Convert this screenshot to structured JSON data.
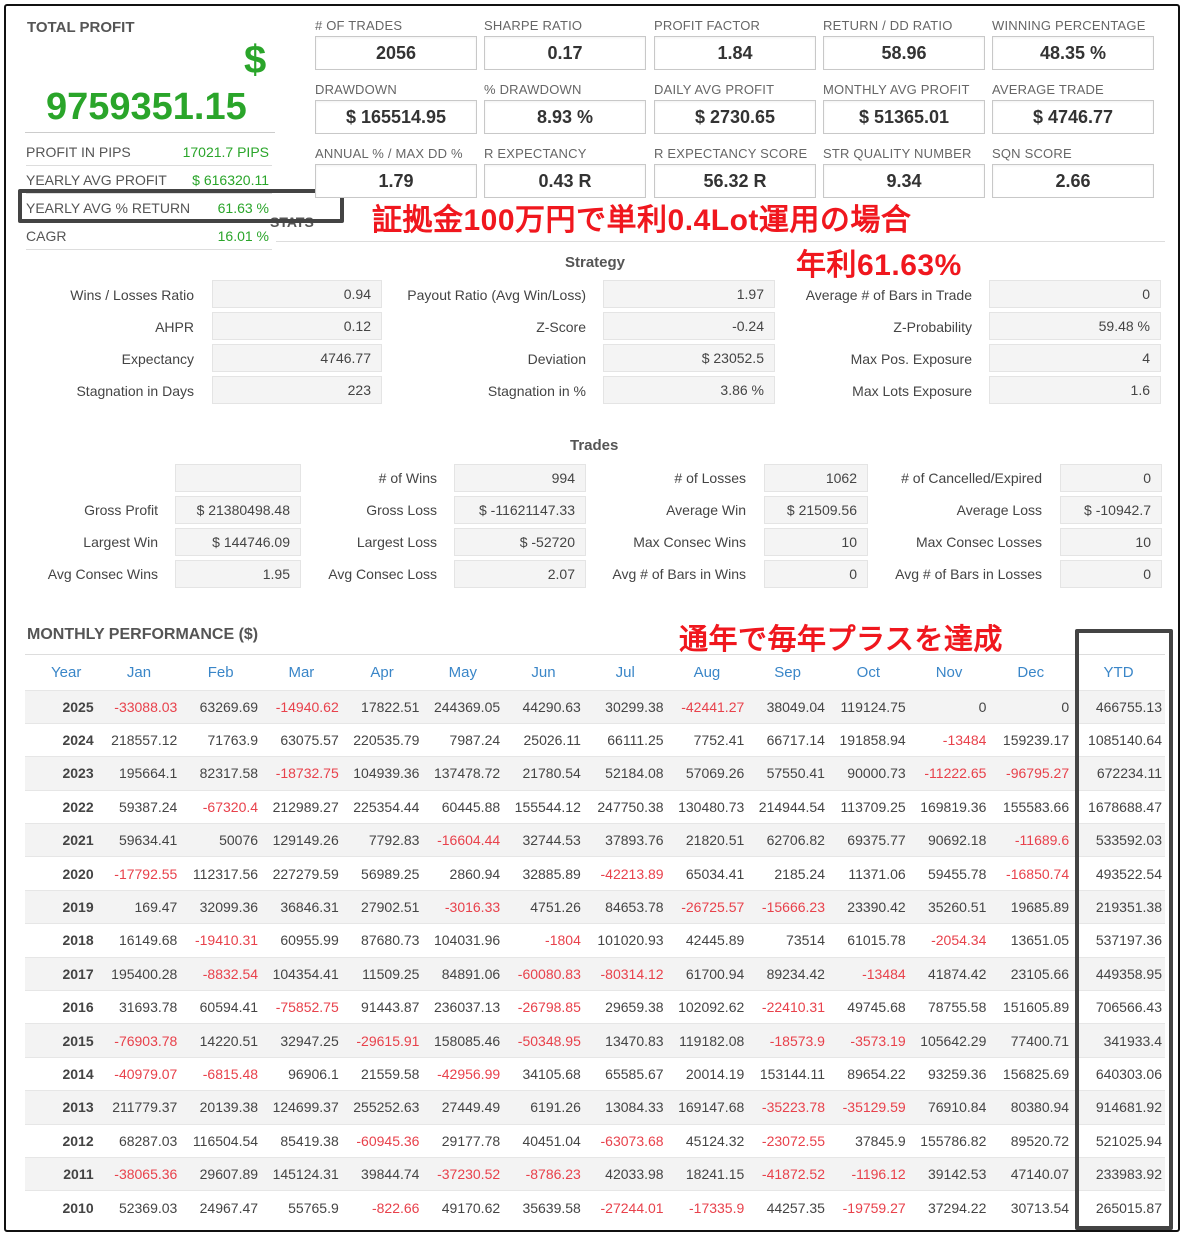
{
  "summary": {
    "total_profit_label": "TOTAL PROFIT",
    "currency_symbol": "$",
    "total_profit_value": "9759351.15",
    "rows": [
      {
        "label": "PROFIT IN PIPS",
        "value": "17021.7 PIPS"
      },
      {
        "label": "YEARLY AVG PROFIT",
        "value": "$ 616320.11"
      },
      {
        "label": "YEARLY AVG % RETURN",
        "value": "61.63 %"
      },
      {
        "label": "CAGR",
        "value": "16.01 %"
      }
    ],
    "stats_fragment": "STATS"
  },
  "kpis": [
    {
      "label": "# OF TRADES",
      "value": "2056"
    },
    {
      "label": "SHARPE RATIO",
      "value": "0.17"
    },
    {
      "label": "PROFIT FACTOR",
      "value": "1.84"
    },
    {
      "label": "RETURN / DD RATIO",
      "value": "58.96"
    },
    {
      "label": "WINNING PERCENTAGE",
      "value": "48.35 %"
    },
    {
      "label": "DRAWDOWN",
      "value": "$ 165514.95"
    },
    {
      "label": "% DRAWDOWN",
      "value": "8.93 %"
    },
    {
      "label": "DAILY AVG PROFIT",
      "value": "$ 2730.65"
    },
    {
      "label": "MONTHLY AVG PROFIT",
      "value": "$ 51365.01"
    },
    {
      "label": "AVERAGE TRADE",
      "value": "$ 4746.77"
    },
    {
      "label": "ANNUAL % / MAX DD %",
      "value": "1.79"
    },
    {
      "label": "R EXPECTANCY",
      "value": "0.43 R"
    },
    {
      "label": "R EXPECTANCY SCORE",
      "value": "56.32 R"
    },
    {
      "label": "STR QUALITY NUMBER",
      "value": "9.34"
    },
    {
      "label": "SQN SCORE",
      "value": "2.66"
    }
  ],
  "annotations": {
    "line1": "証拠金100万円で単利0.4Lot運用の場合",
    "line2": "年利61.63%",
    "line3": "通年で毎年プラスを達成"
  },
  "strategy": {
    "title": "Strategy",
    "rows": [
      [
        {
          "k": "Wins / Losses Ratio",
          "v": "0.94"
        },
        {
          "k": "Payout Ratio (Avg Win/Loss)",
          "v": "1.97"
        },
        {
          "k": "Average # of Bars in Trade",
          "v": "0"
        }
      ],
      [
        {
          "k": "AHPR",
          "v": "0.12"
        },
        {
          "k": "Z-Score",
          "v": "-0.24"
        },
        {
          "k": "Z-Probability",
          "v": "59.48 %"
        }
      ],
      [
        {
          "k": "Expectancy",
          "v": "4746.77"
        },
        {
          "k": "Deviation",
          "v": "$ 23052.5"
        },
        {
          "k": "Max Pos. Exposure",
          "v": "4"
        }
      ],
      [
        {
          "k": "Stagnation in Days",
          "v": "223"
        },
        {
          "k": "Stagnation in %",
          "v": "3.86 %"
        },
        {
          "k": "Max Lots Exposure",
          "v": "1.6"
        }
      ]
    ]
  },
  "trades": {
    "title": "Trades",
    "rows": [
      [
        {
          "k": "",
          "v": ""
        },
        {
          "k": "# of Wins",
          "v": "994"
        },
        {
          "k": "# of Losses",
          "v": "1062"
        },
        {
          "k": "# of Cancelled/Expired",
          "v": "0"
        }
      ],
      [
        {
          "k": "Gross Profit",
          "v": "$ 21380498.48"
        },
        {
          "k": "Gross Loss",
          "v": "$ -11621147.33"
        },
        {
          "k": "Average Win",
          "v": "$ 21509.56"
        },
        {
          "k": "Average Loss",
          "v": "$ -10942.7"
        }
      ],
      [
        {
          "k": "Largest Win",
          "v": "$ 144746.09"
        },
        {
          "k": "Largest Loss",
          "v": "$ -52720"
        },
        {
          "k": "Max Consec Wins",
          "v": "10"
        },
        {
          "k": "Max Consec Losses",
          "v": "10"
        }
      ],
      [
        {
          "k": "Avg Consec Wins",
          "v": "1.95"
        },
        {
          "k": "Avg Consec Loss",
          "v": "2.07"
        },
        {
          "k": "Avg # of Bars in Wins",
          "v": "0"
        },
        {
          "k": "Avg # of Bars in Losses",
          "v": "0"
        }
      ]
    ]
  },
  "monthly": {
    "title": "MONTHLY PERFORMANCE ($)",
    "headers": [
      "Year",
      "Jan",
      "Feb",
      "Mar",
      "Apr",
      "May",
      "Jun",
      "Jul",
      "Aug",
      "Sep",
      "Oct",
      "Nov",
      "Dec",
      "YTD"
    ],
    "rows": [
      [
        "2025",
        "-33088.03",
        "63269.69",
        "-14940.62",
        "17822.51",
        "244369.05",
        "44290.63",
        "30299.38",
        "-42441.27",
        "38049.04",
        "119124.75",
        "0",
        "0",
        "466755.13"
      ],
      [
        "2024",
        "218557.12",
        "71763.9",
        "63075.57",
        "220535.79",
        "7987.24",
        "25026.11",
        "66111.25",
        "7752.41",
        "66717.14",
        "191858.94",
        "-13484",
        "159239.17",
        "1085140.64"
      ],
      [
        "2023",
        "195664.1",
        "82317.58",
        "-18732.75",
        "104939.36",
        "137478.72",
        "21780.54",
        "52184.08",
        "57069.26",
        "57550.41",
        "90000.73",
        "-11222.65",
        "-96795.27",
        "672234.11"
      ],
      [
        "2022",
        "59387.24",
        "-67320.4",
        "212989.27",
        "225354.44",
        "60445.88",
        "155544.12",
        "247750.38",
        "130480.73",
        "214944.54",
        "113709.25",
        "169819.36",
        "155583.66",
        "1678688.47"
      ],
      [
        "2021",
        "59634.41",
        "50076",
        "129149.26",
        "7792.83",
        "-16604.44",
        "32744.53",
        "37893.76",
        "21820.51",
        "62706.82",
        "69375.77",
        "90692.18",
        "-11689.6",
        "533592.03"
      ],
      [
        "2020",
        "-17792.55",
        "112317.56",
        "227279.59",
        "56989.25",
        "2860.94",
        "32885.89",
        "-42213.89",
        "65034.41",
        "2185.24",
        "11371.06",
        "59455.78",
        "-16850.74",
        "493522.54"
      ],
      [
        "2019",
        "169.47",
        "32099.36",
        "36846.31",
        "27902.51",
        "-3016.33",
        "4751.26",
        "84653.78",
        "-26725.57",
        "-15666.23",
        "23390.42",
        "35260.51",
        "19685.89",
        "219351.38"
      ],
      [
        "2018",
        "16149.68",
        "-19410.31",
        "60955.99",
        "87680.73",
        "104031.96",
        "-1804",
        "101020.93",
        "42445.89",
        "73514",
        "61015.78",
        "-2054.34",
        "13651.05",
        "537197.36"
      ],
      [
        "2017",
        "195400.28",
        "-8832.54",
        "104354.41",
        "11509.25",
        "84891.06",
        "-60080.83",
        "-80314.12",
        "61700.94",
        "89234.42",
        "-13484",
        "41874.42",
        "23105.66",
        "449358.95"
      ],
      [
        "2016",
        "31693.78",
        "60594.41",
        "-75852.75",
        "91443.87",
        "236037.13",
        "-26798.85",
        "29659.38",
        "102092.62",
        "-22410.31",
        "49745.68",
        "78755.58",
        "151605.89",
        "706566.43"
      ],
      [
        "2015",
        "-76903.78",
        "14220.51",
        "32947.25",
        "-29615.91",
        "158085.46",
        "-50348.95",
        "13470.83",
        "119182.08",
        "-18573.9",
        "-3573.19",
        "105642.29",
        "77400.71",
        "341933.4"
      ],
      [
        "2014",
        "-40979.07",
        "-6815.48",
        "96906.1",
        "21559.58",
        "-42956.99",
        "34105.68",
        "65585.67",
        "20014.19",
        "153144.11",
        "89654.22",
        "93259.36",
        "156825.69",
        "640303.06"
      ],
      [
        "2013",
        "211779.37",
        "20139.38",
        "124699.37",
        "255252.63",
        "27449.49",
        "6191.26",
        "13084.33",
        "169147.68",
        "-35223.78",
        "-35129.59",
        "76910.84",
        "80380.94",
        "914681.92"
      ],
      [
        "2012",
        "68287.03",
        "116504.54",
        "85419.38",
        "-60945.36",
        "29177.78",
        "40451.04",
        "-63073.68",
        "45124.32",
        "-23072.55",
        "37845.9",
        "155786.82",
        "89520.72",
        "521025.94"
      ],
      [
        "2011",
        "-38065.36",
        "29607.89",
        "145124.31",
        "39844.74",
        "-37230.52",
        "-8786.23",
        "42033.98",
        "18241.15",
        "-41872.52",
        "-1196.12",
        "39142.53",
        "47140.07",
        "233983.92"
      ],
      [
        "2010",
        "52369.03",
        "24967.47",
        "55765.9",
        "-822.66",
        "49170.62",
        "35639.58",
        "-27244.01",
        "-17335.9",
        "44257.35",
        "-19759.27",
        "37294.22",
        "30713.54",
        "265015.87"
      ]
    ]
  },
  "colors": {
    "positive": "#2aa52a",
    "negative": "#e8414b",
    "annotation": "#f0171e",
    "header_blue": "#3a86c8"
  }
}
